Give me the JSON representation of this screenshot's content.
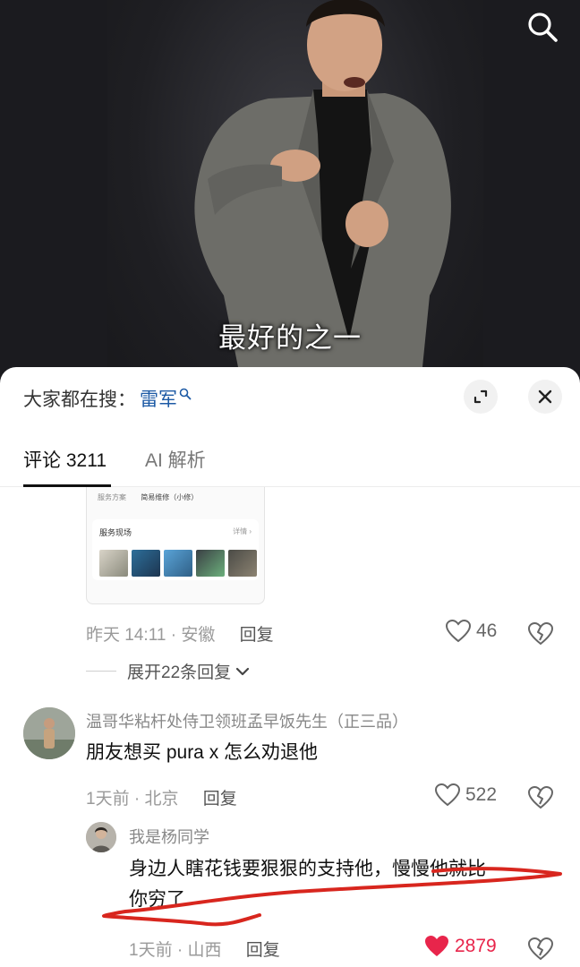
{
  "video": {
    "subtitle": "最好的之一",
    "search_icon": "search-icon"
  },
  "sheet": {
    "search_prefix": "大家都在搜：",
    "search_term": "雷军",
    "expand_icon": "expand-icon",
    "close_icon": "close-icon"
  },
  "tabs": [
    {
      "label": "评论 3211",
      "active": true
    },
    {
      "label": "AI 解析",
      "active": false
    }
  ],
  "first_comment": {
    "attachment": {
      "row_label": "服务方案",
      "row_value": "简易维修（小修）",
      "card_title": "服务现场",
      "card_more": "详情 ›"
    },
    "time": "昨天 14:11",
    "location": "安徽",
    "reply_label": "回复",
    "likes": "46",
    "expand_replies": "展开22条回复"
  },
  "comments": [
    {
      "username": "温哥华粘杆处侍卫领班孟早饭先生（正三品）",
      "text": "朋友想买 pura x 怎么劝退他",
      "time": "1天前",
      "location": "北京",
      "reply_label": "回复",
      "likes": "522",
      "liked": false
    },
    {
      "username": "我是杨同学",
      "text_line1": "身边人瞎花钱要狠狠的支持他，慢慢他就比",
      "text_line2": "你穷了",
      "time": "1天前",
      "location": "山西",
      "reply_label": "回复",
      "likes": "2879",
      "liked": true
    }
  ],
  "colors": {
    "link_blue": "#1d5aa5",
    "like_red": "#e8254b",
    "annotation_red": "#d8261e"
  }
}
